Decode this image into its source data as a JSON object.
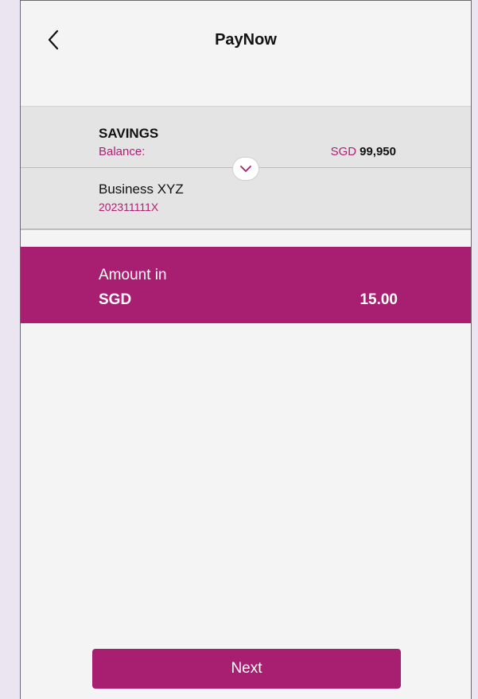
{
  "header": {
    "title": "PayNow",
    "back_icon": "chevron-left-icon"
  },
  "account": {
    "name": "SAVINGS",
    "balance_label": "Balance:",
    "balance_currency": "SGD",
    "balance_amount": "99,950"
  },
  "payee": {
    "name": "Business XYZ",
    "id": "202311111X"
  },
  "dropdown_icon": "chevron-down-icon",
  "amount": {
    "label": "Amount in",
    "currency": "SGD",
    "value": "15.00"
  },
  "footer": {
    "next_label": "Next"
  },
  "colors": {
    "brand": "#a81f72",
    "background": "#f4f4f4",
    "outer_background": "#ebe5f2"
  }
}
